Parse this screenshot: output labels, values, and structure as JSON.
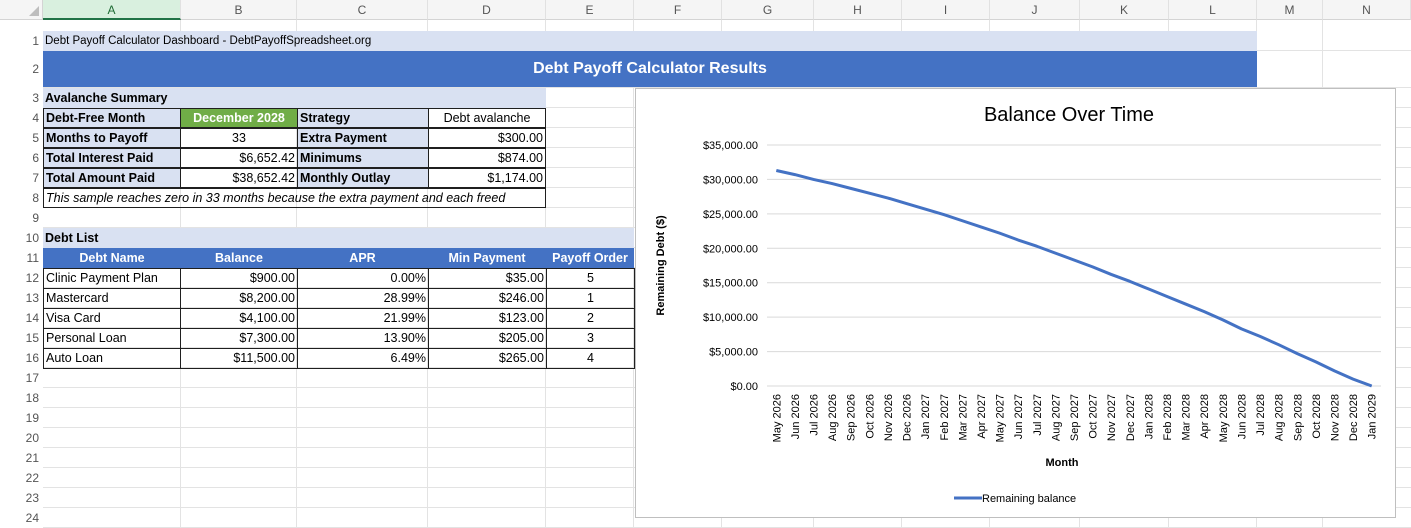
{
  "columns": [
    "A",
    "B",
    "C",
    "D",
    "E",
    "F",
    "G",
    "H",
    "I",
    "J",
    "K",
    "L",
    "M",
    "N"
  ],
  "rows": [
    "1",
    "2",
    "3",
    "4",
    "5",
    "6",
    "7",
    "8",
    "9",
    "10",
    "11",
    "12",
    "13",
    "14",
    "15",
    "16",
    "17",
    "18",
    "19",
    "20",
    "21",
    "22",
    "23",
    "24"
  ],
  "sheet": {
    "a1": "Debt Payoff Calculator Dashboard - DebtPayoffSpreadsheet.org",
    "banner": "Debt Payoff Calculator Results",
    "summary_title": "Avalanche Summary",
    "debt_free_label": "Debt-Free Month",
    "debt_free_value": "December 2028",
    "strategy_label": "Strategy",
    "strategy_value": "Debt avalanche",
    "months_label": "Months to Payoff",
    "months_value": "33",
    "extra_label": "Extra Payment",
    "extra_value": "$300.00",
    "interest_label": "Total Interest Paid",
    "interest_value": "$6,652.42",
    "minimums_label": "Minimums",
    "minimums_value": "$874.00",
    "total_label": "Total Amount Paid",
    "total_value": "$38,652.42",
    "outlay_label": "Monthly Outlay",
    "outlay_value": "$1,174.00",
    "note": "This sample reaches zero in 33 months because the extra payment and each freed",
    "debt_list_title": "Debt List",
    "table_headers": [
      "Debt Name",
      "Balance",
      "APR",
      "Min Payment",
      "Payoff Order"
    ],
    "debts": [
      {
        "name": "Clinic Payment Plan",
        "balance": "$900.00",
        "apr": "0.00%",
        "min": "$35.00",
        "order": "5"
      },
      {
        "name": "Mastercard",
        "balance": "$8,200.00",
        "apr": "28.99%",
        "min": "$246.00",
        "order": "1"
      },
      {
        "name": "Visa Card",
        "balance": "$4,100.00",
        "apr": "21.99%",
        "min": "$123.00",
        "order": "2"
      },
      {
        "name": "Personal Loan",
        "balance": "$7,300.00",
        "apr": "13.90%",
        "min": "$205.00",
        "order": "3"
      },
      {
        "name": "Auto Loan",
        "balance": "$11,500.00",
        "apr": "6.49%",
        "min": "$265.00",
        "order": "4"
      }
    ]
  },
  "colors": {
    "accent": "#4472c4",
    "green": "#70ad47",
    "light_blue": "#d9e1f2",
    "line": "#4472c4"
  },
  "chart_data": {
    "type": "line",
    "title": "Balance Over Time",
    "xlabel": "Month",
    "ylabel": "Remaining Debt ($)",
    "ylim": [
      0,
      35000
    ],
    "yticks": [
      "$0.00",
      "$5,000.00",
      "$10,000.00",
      "$15,000.00",
      "$20,000.00",
      "$25,000.00",
      "$30,000.00",
      "$35,000.00"
    ],
    "ytick_values": [
      0,
      5000,
      10000,
      15000,
      20000,
      25000,
      30000,
      35000
    ],
    "grid": true,
    "legend": "bottom",
    "categories": [
      "May 2026",
      "Jun 2026",
      "Jul 2026",
      "Aug 2026",
      "Sep 2026",
      "Oct 2026",
      "Nov 2026",
      "Dec 2026",
      "Jan 2027",
      "Feb 2027",
      "Mar 2027",
      "Apr 2027",
      "May 2027",
      "Jun 2027",
      "Jul 2027",
      "Aug 2027",
      "Sep 2027",
      "Oct 2027",
      "Nov 2027",
      "Dec 2027",
      "Jan 2028",
      "Feb 2028",
      "Mar 2028",
      "Apr 2028",
      "May 2028",
      "Jun 2028",
      "Jul 2028",
      "Aug 2028",
      "Sep 2028",
      "Oct 2028",
      "Nov 2028",
      "Dec 2028",
      "Jan 2029"
    ],
    "series": [
      {
        "name": "Remaining balance",
        "values": [
          31300,
          30700,
          30000,
          29400,
          28700,
          28000,
          27300,
          26500,
          25700,
          24900,
          24000,
          23100,
          22200,
          21200,
          20300,
          19300,
          18300,
          17300,
          16200,
          15200,
          14100,
          13000,
          11900,
          10800,
          9600,
          8300,
          7200,
          6000,
          4700,
          3500,
          2200,
          1000,
          0
        ]
      }
    ]
  }
}
